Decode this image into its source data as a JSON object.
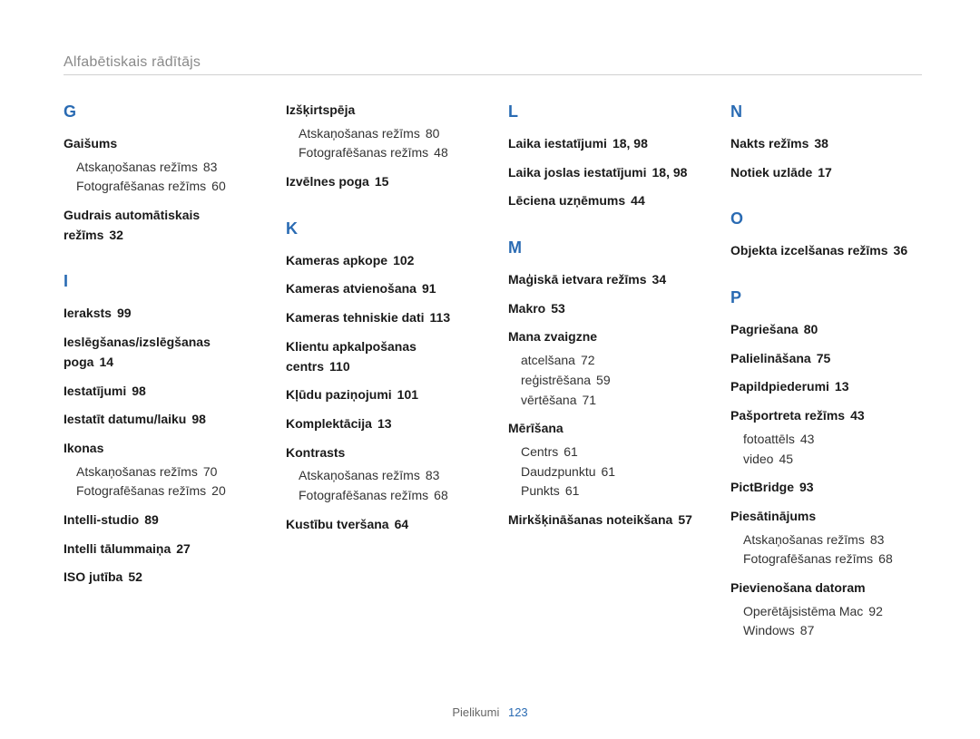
{
  "running_head": "Alfabētiskais rādītājs",
  "footer": {
    "label": "Pielikumi",
    "page": "123"
  },
  "columns": [
    [
      {
        "type": "letter",
        "text": "G"
      },
      {
        "type": "entry",
        "term": "Gaišums",
        "subs": [
          {
            "term": "Atskaņošanas režīms",
            "page": "83"
          },
          {
            "term": "Fotografēšanas režīms",
            "page": "60"
          }
        ]
      },
      {
        "type": "entry",
        "term": "Gudrais automātiskais režīms",
        "page": "32"
      },
      {
        "type": "letter",
        "text": "I"
      },
      {
        "type": "entry",
        "term": "Ieraksts",
        "page": "99"
      },
      {
        "type": "entry",
        "term": "Ieslēgšanas/izslēgšanas poga",
        "page": "14"
      },
      {
        "type": "entry",
        "term": "Iestatījumi",
        "page": "98"
      },
      {
        "type": "entry",
        "term": "Iestatīt datumu/laiku",
        "page": "98"
      },
      {
        "type": "entry",
        "term": "Ikonas",
        "subs": [
          {
            "term": "Atskaņošanas režīms",
            "page": "70"
          },
          {
            "term": "Fotografēšanas režīms",
            "page": "20"
          }
        ]
      },
      {
        "type": "entry",
        "term": "Intelli-studio",
        "page": "89"
      },
      {
        "type": "entry",
        "term": "Intelli tālummaiņa",
        "page": "27"
      },
      {
        "type": "entry",
        "term": "ISO jutība",
        "page": "52"
      }
    ],
    [
      {
        "type": "entry",
        "term": "Izšķirtspēja",
        "subs": [
          {
            "term": "Atskaņošanas režīms",
            "page": "80"
          },
          {
            "term": "Fotografēšanas režīms",
            "page": "48"
          }
        ]
      },
      {
        "type": "entry",
        "term": "Izvēlnes poga",
        "page": "15"
      },
      {
        "type": "letter",
        "text": "K"
      },
      {
        "type": "entry",
        "term": "Kameras apkope",
        "page": "102"
      },
      {
        "type": "entry",
        "term": "Kameras atvienošana",
        "page": "91"
      },
      {
        "type": "entry",
        "term": "Kameras tehniskie dati",
        "page": "113"
      },
      {
        "type": "entry",
        "term": "Klientu apkalpošanas centrs",
        "page": "110"
      },
      {
        "type": "entry",
        "term": "Kļūdu paziņojumi",
        "page": "101"
      },
      {
        "type": "entry",
        "term": "Komplektācija",
        "page": "13"
      },
      {
        "type": "entry",
        "term": "Kontrasts",
        "subs": [
          {
            "term": "Atskaņošanas režīms",
            "page": "83"
          },
          {
            "term": "Fotografēšanas režīms",
            "page": "68"
          }
        ]
      },
      {
        "type": "entry",
        "term": "Kustību tveršana",
        "page": "64"
      }
    ],
    [
      {
        "type": "letter",
        "text": "L"
      },
      {
        "type": "entry",
        "term": "Laika iestatījumi",
        "page": "18, 98"
      },
      {
        "type": "entry",
        "term": "Laika joslas iestatījumi",
        "page": "18, 98"
      },
      {
        "type": "entry",
        "term": "Lēciena uzņēmums",
        "page": "44"
      },
      {
        "type": "letter",
        "text": "M"
      },
      {
        "type": "entry",
        "term": "Maģiskā ietvara režīms",
        "page": "34"
      },
      {
        "type": "entry",
        "term": "Makro",
        "page": "53"
      },
      {
        "type": "entry",
        "term": "Mana zvaigzne",
        "subs": [
          {
            "term": "atcelšana",
            "page": "72"
          },
          {
            "term": "reģistrēšana",
            "page": "59"
          },
          {
            "term": "vērtēšana",
            "page": "71"
          }
        ]
      },
      {
        "type": "entry",
        "term": "Mērīšana",
        "subs": [
          {
            "term": "Centrs",
            "page": "61"
          },
          {
            "term": "Daudzpunktu",
            "page": "61"
          },
          {
            "term": "Punkts",
            "page": "61"
          }
        ]
      },
      {
        "type": "entry",
        "term": "Mirkšķināšanas noteikšana",
        "page": "57"
      }
    ],
    [
      {
        "type": "letter",
        "text": "N"
      },
      {
        "type": "entry",
        "term": "Nakts režīms",
        "page": "38"
      },
      {
        "type": "entry",
        "term": "Notiek uzlāde",
        "page": "17"
      },
      {
        "type": "letter",
        "text": "O"
      },
      {
        "type": "entry",
        "term": "Objekta izcelšanas režīms",
        "page": "36"
      },
      {
        "type": "letter",
        "text": "P"
      },
      {
        "type": "entry",
        "term": "Pagriešana",
        "page": "80"
      },
      {
        "type": "entry",
        "term": "Palielināšana",
        "page": "75"
      },
      {
        "type": "entry",
        "term": "Papildpiederumi",
        "page": "13"
      },
      {
        "type": "entry",
        "term": "Pašportreta režīms",
        "page": "43",
        "subs": [
          {
            "term": "fotoattēls",
            "page": "43"
          },
          {
            "term": "video",
            "page": "45"
          }
        ]
      },
      {
        "type": "entry",
        "term": "PictBridge",
        "page": "93"
      },
      {
        "type": "entry",
        "term": "Piesātinājums",
        "subs": [
          {
            "term": "Atskaņošanas režīms",
            "page": "83"
          },
          {
            "term": "Fotografēšanas režīms",
            "page": "68"
          }
        ]
      },
      {
        "type": "entry",
        "term": "Pievienošana datoram",
        "subs": [
          {
            "term": "Operētājsistēma Mac",
            "page": "92"
          },
          {
            "term": "Windows",
            "page": "87"
          }
        ]
      }
    ]
  ]
}
